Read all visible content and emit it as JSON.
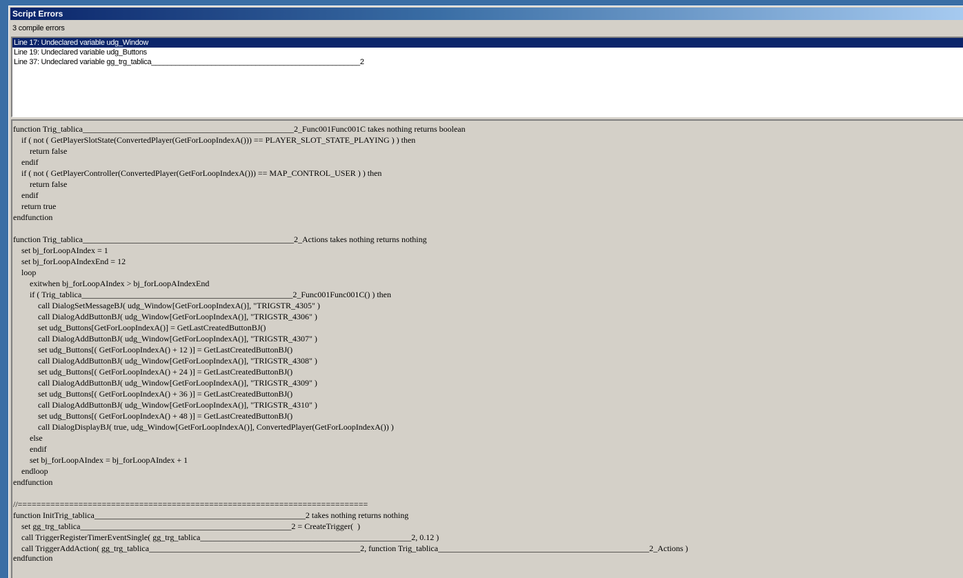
{
  "window": {
    "title": "Script Errors",
    "status": "3 compile errors"
  },
  "errors": [
    "Line 17: Undeclared variable udg_Window",
    "Line 19: Undeclared variable udg_Buttons",
    "Line 37: Undeclared variable gg_trg_tablica____________________________________________________2"
  ],
  "code": [
    "function Trig_tablica___________________________________________________2_Func001Func001C takes nothing returns boolean",
    "    if ( not ( GetPlayerSlotState(ConvertedPlayer(GetForLoopIndexA())) == PLAYER_SLOT_STATE_PLAYING ) ) then",
    "        return false",
    "    endif",
    "    if ( not ( GetPlayerController(ConvertedPlayer(GetForLoopIndexA())) == MAP_CONTROL_USER ) ) then",
    "        return false",
    "    endif",
    "    return true",
    "endfunction",
    "",
    "function Trig_tablica___________________________________________________2_Actions takes nothing returns nothing",
    "    set bj_forLoopAIndex = 1",
    "    set bj_forLoopAIndexEnd = 12",
    "    loop",
    "        exitwhen bj_forLoopAIndex > bj_forLoopAIndexEnd",
    "        if ( Trig_tablica___________________________________________________2_Func001Func001C() ) then",
    "            call DialogSetMessageBJ( udg_Window[GetForLoopIndexA()], \"TRIGSTR_4305\" )",
    "            call DialogAddButtonBJ( udg_Window[GetForLoopIndexA()], \"TRIGSTR_4306\" )",
    "            set udg_Buttons[GetForLoopIndexA()] = GetLastCreatedButtonBJ()",
    "            call DialogAddButtonBJ( udg_Window[GetForLoopIndexA()], \"TRIGSTR_4307\" )",
    "            set udg_Buttons[( GetForLoopIndexA() + 12 )] = GetLastCreatedButtonBJ()",
    "            call DialogAddButtonBJ( udg_Window[GetForLoopIndexA()], \"TRIGSTR_4308\" )",
    "            set udg_Buttons[( GetForLoopIndexA() + 24 )] = GetLastCreatedButtonBJ()",
    "            call DialogAddButtonBJ( udg_Window[GetForLoopIndexA()], \"TRIGSTR_4309\" )",
    "            set udg_Buttons[( GetForLoopIndexA() + 36 )] = GetLastCreatedButtonBJ()",
    "            call DialogAddButtonBJ( udg_Window[GetForLoopIndexA()], \"TRIGSTR_4310\" )",
    "            set udg_Buttons[( GetForLoopIndexA() + 48 )] = GetLastCreatedButtonBJ()",
    "            call DialogDisplayBJ( true, udg_Window[GetForLoopIndexA()], ConvertedPlayer(GetForLoopIndexA()) )",
    "        else",
    "        endif",
    "        set bj_forLoopAIndex = bj_forLoopAIndex + 1",
    "    endloop",
    "endfunction",
    "",
    "//===========================================================================",
    "function InitTrig_tablica___________________________________________________2 takes nothing returns nothing",
    "    set gg_trg_tablica___________________________________________________2 = CreateTrigger(  )",
    "    call TriggerRegisterTimerEventSingle( gg_trg_tablica___________________________________________________2, 0.12 )",
    "    call TriggerAddAction( gg_trg_tablica___________________________________________________2, function Trig_tablica___________________________________________________2_Actions )",
    "endfunction"
  ],
  "colors": {
    "selection": "#0a246a",
    "title_start": "#0a246a",
    "title_end": "#a6caf0",
    "face": "#d4d0c8"
  }
}
